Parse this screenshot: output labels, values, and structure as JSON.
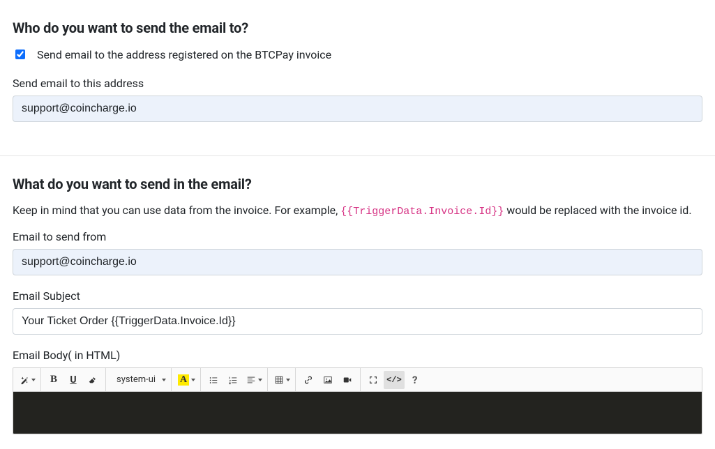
{
  "sectionTo": {
    "heading": "Who do you want to send the email to?",
    "checkboxLabel": "Send email to the address registered on the BTCPay invoice",
    "checkboxChecked": true,
    "addressLabel": "Send email to this address",
    "addressValue": "support@coincharge.io"
  },
  "sectionContent": {
    "heading": "What do you want to send in the email?",
    "hintPrefix": "Keep in mind that you can use data from the invoice. For example, ",
    "hintCode": "{{TriggerData.Invoice.Id}}",
    "hintSuffix": " would be replaced with the invoice id.",
    "fromLabel": "Email to send from",
    "fromValue": "support@coincharge.io",
    "subjectLabel": "Email Subject",
    "subjectValue": "Your Ticket Order {{TriggerData.Invoice.Id}}",
    "bodyLabel": "Email Body( in HTML)"
  },
  "editor": {
    "fontName": "system-ui",
    "tools": {
      "magic": "magic-wand",
      "bold": "B",
      "underline": "U",
      "eraser": "eraser",
      "fontColor": "A",
      "ul": "unordered-list",
      "ol": "ordered-list",
      "align": "align",
      "table": "table",
      "link": "link",
      "image": "image",
      "video": "video",
      "fullscreen": "fullscreen",
      "code": "</>",
      "help": "?"
    }
  }
}
